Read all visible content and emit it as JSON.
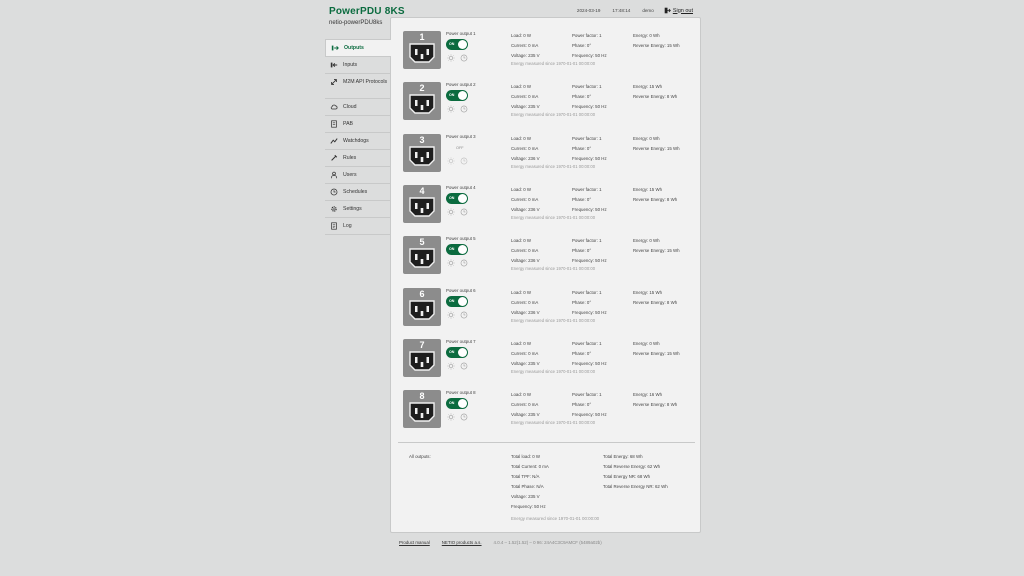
{
  "header": {
    "title": "PowerPDU 8KS",
    "hostname": "netio-powerPDU8ks",
    "date": "2024-03-19",
    "time": "17:48:14",
    "user": "demo",
    "signout": "Sign out"
  },
  "colors": {
    "accent": "#0b6b3f",
    "plug_bg": "#8c8c8c",
    "panel_bg": "#f2f2f2",
    "page_bg": "#dcdddd"
  },
  "sidebar": {
    "items": [
      {
        "label": "Outputs",
        "icon": "outputs-icon",
        "active": true
      },
      {
        "label": "Inputs",
        "icon": "inputs-icon"
      },
      {
        "label": "M2M API Protocols",
        "icon": "m2m-icon"
      },
      {
        "label": "Cloud",
        "icon": "cloud-icon"
      },
      {
        "label": "PAB",
        "icon": "pab-icon"
      },
      {
        "label": "Watchdogs",
        "icon": "watchdog-icon"
      },
      {
        "label": "Rules",
        "icon": "rules-icon"
      },
      {
        "label": "Users",
        "icon": "users-icon"
      },
      {
        "label": "Schedules",
        "icon": "schedules-icon"
      },
      {
        "label": "Settings",
        "icon": "settings-icon"
      },
      {
        "label": "Log",
        "icon": "log-icon"
      }
    ]
  },
  "outputs": [
    {
      "number": "1",
      "name": "Power output 1",
      "state": "ON",
      "load": "Load: 0 W",
      "current": "Current: 0 mA",
      "voltage": "Voltage: 235 V",
      "pf": "Power factor: 1",
      "phase": "Phase: 0°",
      "freq": "Frequency: 50 Hz",
      "energy": "Energy: 0 Wh",
      "rev": "Reverse Energy: 15 Wh",
      "since": "Energy measured since 1970-01-01 00:00:00"
    },
    {
      "number": "2",
      "name": "Power output 2",
      "state": "ON",
      "load": "Load: 0 W",
      "current": "Current: 0 mA",
      "voltage": "Voltage: 235 V",
      "pf": "Power factor: 1",
      "phase": "Phase: 0°",
      "freq": "Frequency: 50 Hz",
      "energy": "Energy: 15 Wh",
      "rev": "Reverse Energy: 8 Wh",
      "since": "Energy measured since 1970-01-01 00:00:00"
    },
    {
      "number": "3",
      "name": "Power output 3",
      "state": "OFF",
      "load": "Load: 0 W",
      "current": "Current: 0 mA",
      "voltage": "Voltage: 236 V",
      "pf": "Power factor: 1",
      "phase": "Phase: 0°",
      "freq": "Frequency: 50 Hz",
      "energy": "Energy: 0 Wh",
      "rev": "Reverse Energy: 15 Wh",
      "since": "Energy measured since 1970-01-01 00:00:00"
    },
    {
      "number": "4",
      "name": "Power output 4",
      "state": "ON",
      "load": "Load: 0 W",
      "current": "Current: 0 mA",
      "voltage": "Voltage: 236 V",
      "pf": "Power factor: 1",
      "phase": "Phase: 0°",
      "freq": "Frequency: 50 Hz",
      "energy": "Energy: 15 Wh",
      "rev": "Reverse Energy: 8 Wh",
      "since": "Energy measured since 1970-01-01 00:00:00"
    },
    {
      "number": "5",
      "name": "Power output 5",
      "state": "ON",
      "load": "Load: 0 W",
      "current": "Current: 0 mA",
      "voltage": "Voltage: 236 V",
      "pf": "Power factor: 1",
      "phase": "Phase: 0°",
      "freq": "Frequency: 50 Hz",
      "energy": "Energy: 0 Wh",
      "rev": "Reverse Energy: 15 Wh",
      "since": "Energy measured since 1970-01-01 00:00:00"
    },
    {
      "number": "6",
      "name": "Power output 6",
      "state": "ON",
      "load": "Load: 0 W",
      "current": "Current: 0 mA",
      "voltage": "Voltage: 236 V",
      "pf": "Power factor: 1",
      "phase": "Phase: 0°",
      "freq": "Frequency: 50 Hz",
      "energy": "Energy: 15 Wh",
      "rev": "Reverse Energy: 8 Wh",
      "since": "Energy measured since 1970-01-01 00:00:00"
    },
    {
      "number": "7",
      "name": "Power output 7",
      "state": "ON",
      "load": "Load: 0 W",
      "current": "Current: 0 mA",
      "voltage": "Voltage: 235 V",
      "pf": "Power factor: 1",
      "phase": "Phase: 0°",
      "freq": "Frequency: 50 Hz",
      "energy": "Energy: 0 Wh",
      "rev": "Reverse Energy: 15 Wh",
      "since": "Energy measured since 1970-01-01 00:00:00"
    },
    {
      "number": "8",
      "name": "Power output 8",
      "state": "ON",
      "load": "Load: 0 W",
      "current": "Current: 0 mA",
      "voltage": "Voltage: 235 V",
      "pf": "Power factor: 1",
      "phase": "Phase: 0°",
      "freq": "Frequency: 50 Hz",
      "energy": "Energy: 16 Wh",
      "rev": "Reverse Energy: 8 Wh",
      "since": "Energy measured since 1970-01-01 00:00:00"
    }
  ],
  "totals": {
    "label": "All outputs:",
    "load": "Total load: 0 W",
    "current": "Total Current: 0 mA",
    "tpf": "Total TPF: N/A",
    "phase": "Total Phase: N/A",
    "voltage": "Voltage: 235 V",
    "freq": "Frequency: 50 Hz",
    "energy": "Total Energy: 68 Wh",
    "rev": "Total Reverse Energy: 62 Wh",
    "energy_nr": "Total Energy NR: 68 Wh",
    "rev_nr": "Total Reverse Energy NR: 62 Wh",
    "since": "Energy measured since 1970-01-01 00:00:00"
  },
  "footer": {
    "manual": "Product manual",
    "company": "NETIO products a.s.",
    "version": "4.0.4 – 1.52(1.52) – 0 96: 24A4C3C9AMCF (5489a02b)"
  }
}
